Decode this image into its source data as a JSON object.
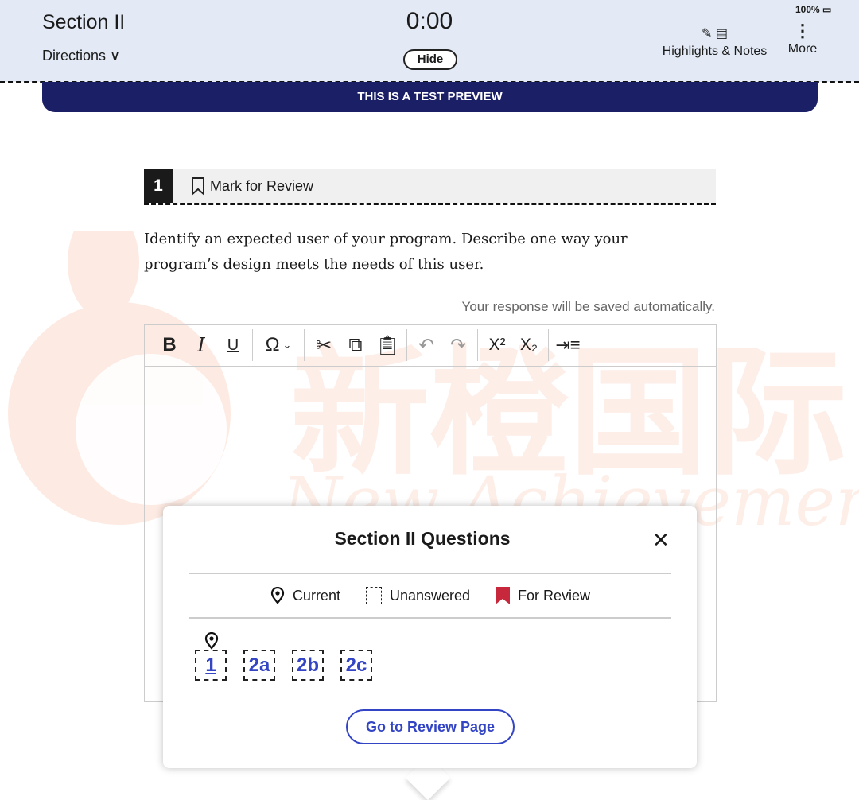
{
  "header": {
    "section_title": "Section II",
    "directions_label": "Directions",
    "timer": "0:00",
    "hide_label": "Hide",
    "battery": "100%",
    "highlights_label": "Highlights & Notes",
    "more_label": "More"
  },
  "banner": "THIS IS A TEST PREVIEW",
  "watermark": {
    "chinese": "新橙国际",
    "english": "New Achievements"
  },
  "question": {
    "number": "1",
    "mark_label": "Mark for Review",
    "text": "Identify an expected user of your program. Describe one way your program’s design meets the needs of this user.",
    "saved_note": "Your response will be saved automatically."
  },
  "toolbar": {
    "bold": "B",
    "italic": "I",
    "underline": "U",
    "omega": "Ω",
    "superscript": "X²",
    "subscript": "X₂"
  },
  "popup": {
    "title": "Section II Questions",
    "legend": {
      "current": "Current",
      "unanswered": "Unanswered",
      "for_review": "For Review"
    },
    "questions": [
      "1",
      "2a",
      "2b",
      "2c"
    ],
    "current": "1",
    "review_button": "Go to Review Page",
    "accent": "#3345c4",
    "review_color": "#c8283c"
  },
  "colors": {
    "header_bg": "#e3eaf5",
    "banner_bg": "#1b1f66"
  }
}
